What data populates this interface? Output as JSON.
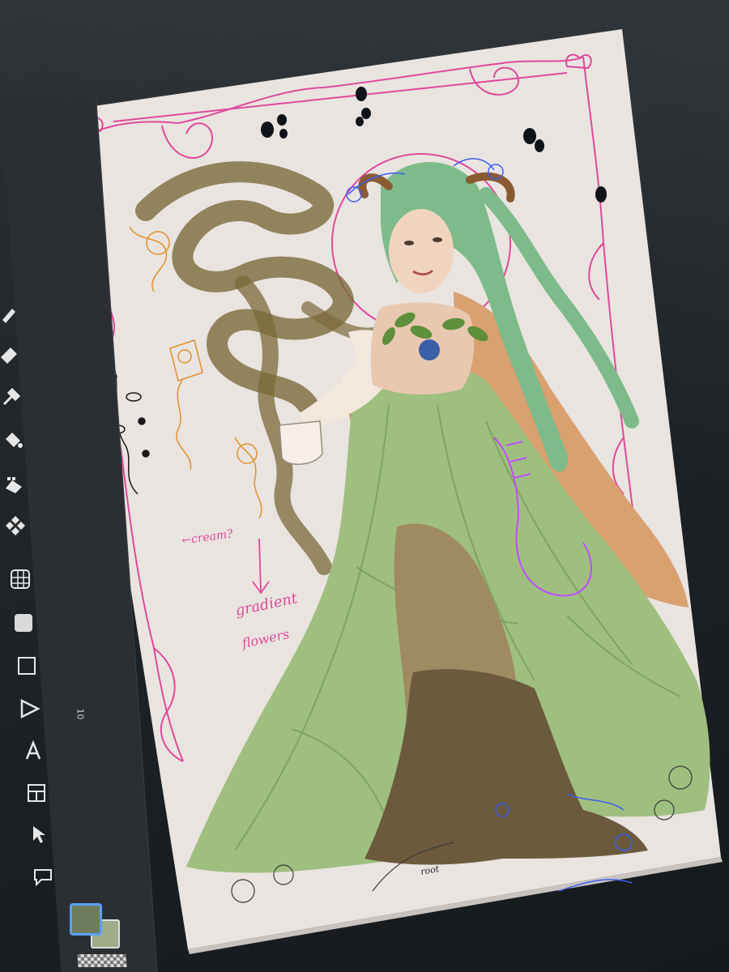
{
  "app": {
    "name": ""
  },
  "toolbar": {
    "tools": [
      {
        "name": "brush-tool",
        "icon": "brush-icon"
      },
      {
        "name": "eraser-tool",
        "icon": "eraser-icon"
      },
      {
        "name": "eyedropper-tool",
        "icon": "eyedropper-icon"
      },
      {
        "name": "fill-tool",
        "icon": "bucket-icon"
      },
      {
        "name": "gradient-fill-tool",
        "icon": "gradient-icon"
      },
      {
        "name": "blend-tool",
        "icon": "blend-icon"
      },
      {
        "name": "grid-tool",
        "icon": "grid-icon"
      },
      {
        "name": "shape-tool",
        "icon": "rounded-square-icon"
      },
      {
        "name": "selection-tool",
        "icon": "square-outline-icon"
      },
      {
        "name": "lasso-tool",
        "icon": "triangle-icon"
      },
      {
        "name": "text-tool",
        "icon": "text-a-icon"
      },
      {
        "name": "frame-tool",
        "icon": "frame-icon"
      },
      {
        "name": "move-tool",
        "icon": "cursor-icon"
      },
      {
        "name": "speech-balloon-tool",
        "icon": "speech-icon"
      }
    ],
    "ruler_label": "10",
    "colors": {
      "foreground": "#6f7c5c",
      "background": "#a0ab8a"
    }
  },
  "canvas": {
    "annotations": {
      "note_cream": "←cream?",
      "note_gradient": "gradient",
      "note_flowers": "flowers",
      "note_root": "root"
    },
    "palette": {
      "paper": "#e9e4e0",
      "frame_pink": "#e0489b",
      "dress_green": "#9fbf7f",
      "hair_green": "#7dbb8a",
      "cape_orange": "#d9a070",
      "smoke_brown": "#7a6a3a",
      "sketch_blue": "#3a5ff0",
      "sketch_violet": "#c04bff",
      "sketch_orange": "#e3902a"
    }
  }
}
